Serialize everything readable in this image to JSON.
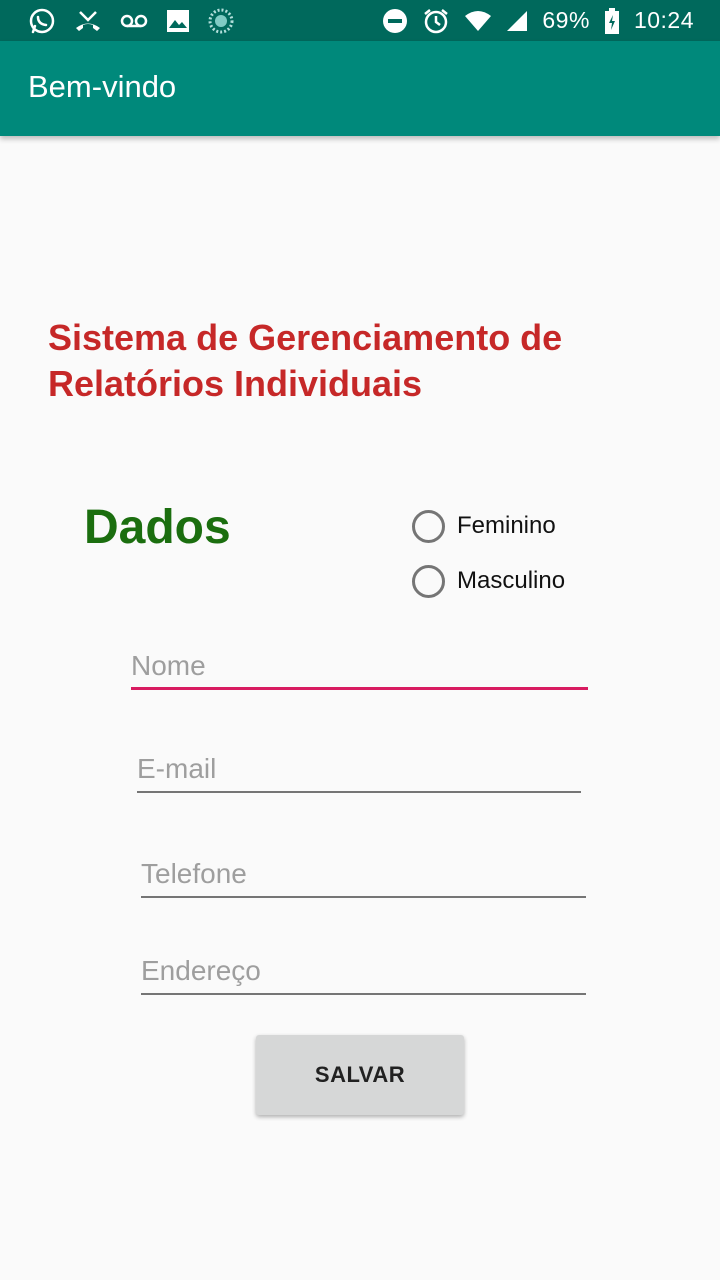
{
  "status_bar": {
    "left_icons": [
      "whatsapp-icon",
      "missed-call-icon",
      "voicemail-icon",
      "image-icon",
      "sync-circle-icon"
    ],
    "right_icons": [
      "do-not-disturb-icon",
      "alarm-icon",
      "wifi-icon",
      "signal-icon"
    ],
    "battery_percent": "69%",
    "battery_icon": "battery-charging-icon",
    "time": "10:24"
  },
  "app_bar": {
    "title": "Bem-vindo",
    "background_color": "#00897b",
    "status_bar_color": "#00695c"
  },
  "main": {
    "heading": "Sistema de Gerenciamento de Relatórios Individuais",
    "heading_color": "#c62828",
    "section_label": "Dados",
    "section_label_color": "#1b6e0f",
    "gender_options": [
      {
        "label": "Feminino",
        "selected": false
      },
      {
        "label": "Masculino",
        "selected": false
      }
    ],
    "fields": {
      "name": {
        "placeholder": "Nome",
        "value": ""
      },
      "email": {
        "placeholder": "E-mail",
        "value": ""
      },
      "phone": {
        "placeholder": "Telefone",
        "value": ""
      },
      "address": {
        "placeholder": "Endereço",
        "value": ""
      }
    },
    "focus_accent_color": "#d81b60",
    "save_label": "SALVAR"
  }
}
